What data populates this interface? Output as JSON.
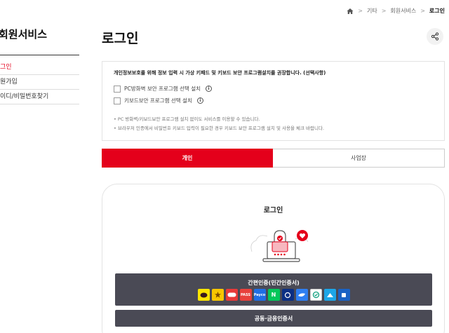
{
  "breadcrumb": {
    "items": [
      "기타",
      "회원서비스",
      "로그인"
    ]
  },
  "sidebar": {
    "title": "회원서비스",
    "items": [
      {
        "label": "그인",
        "active": true
      },
      {
        "label": "원가입",
        "active": false
      },
      {
        "label": "이디/비밀번호찾기",
        "active": false
      }
    ]
  },
  "page": {
    "title": "로그인"
  },
  "notice": {
    "heading": "개인정보보호를 위해 정보 입력 시 가상 키패드 및 키보드 보안 프로그램설치를 권장합니다. (선택사항)",
    "options": [
      {
        "label": "PC방화벽 보안 프로그램 선택 설치",
        "info": "i"
      },
      {
        "label": "키보드보안 프로그램 선택 설치",
        "info": "i"
      }
    ],
    "notes": [
      "• PC 방화벽/키보드보안 프로그램 설치 없이도 서비스를 이용할 수 있습니다.",
      "• 브라우저 인증에서 비밀번호 키보드 입력이 필요한 경우 키보드 보안 프로그램 설치 및 사용을 체크 바랍니다."
    ]
  },
  "tabs": [
    {
      "label": "개인",
      "active": true
    },
    {
      "label": "사업장",
      "active": false
    }
  ],
  "login_card": {
    "title": "로그인",
    "simple_auth_label": "간편인증(민간인증서)",
    "providers": [
      {
        "name": "kakao",
        "text": "",
        "color": "#fee500"
      },
      {
        "name": "naver-mydata",
        "text": "",
        "color": "#f7c600"
      },
      {
        "name": "samsung-pass",
        "text": "",
        "color": "#e83a3a"
      },
      {
        "name": "pass",
        "text": "PASS",
        "color": "#e8413c"
      },
      {
        "name": "payco",
        "text": "Payco",
        "color": "#1f6fe5"
      },
      {
        "name": "naver",
        "text": "N",
        "color": "#03c75a"
      },
      {
        "name": "shinhan",
        "text": "",
        "color": "#0b2f84"
      },
      {
        "name": "toss",
        "text": "",
        "color": "#2f7ff2"
      },
      {
        "name": "kb",
        "text": "",
        "color": "#11a07f"
      },
      {
        "name": "nh",
        "text": "",
        "color": "#1da6e8"
      },
      {
        "name": "woori",
        "text": "",
        "color": "#1a62c4"
      }
    ],
    "cert_label": "공동·금융인증서"
  },
  "colors": {
    "accent": "#e4001b",
    "button": "#4a4a55"
  }
}
